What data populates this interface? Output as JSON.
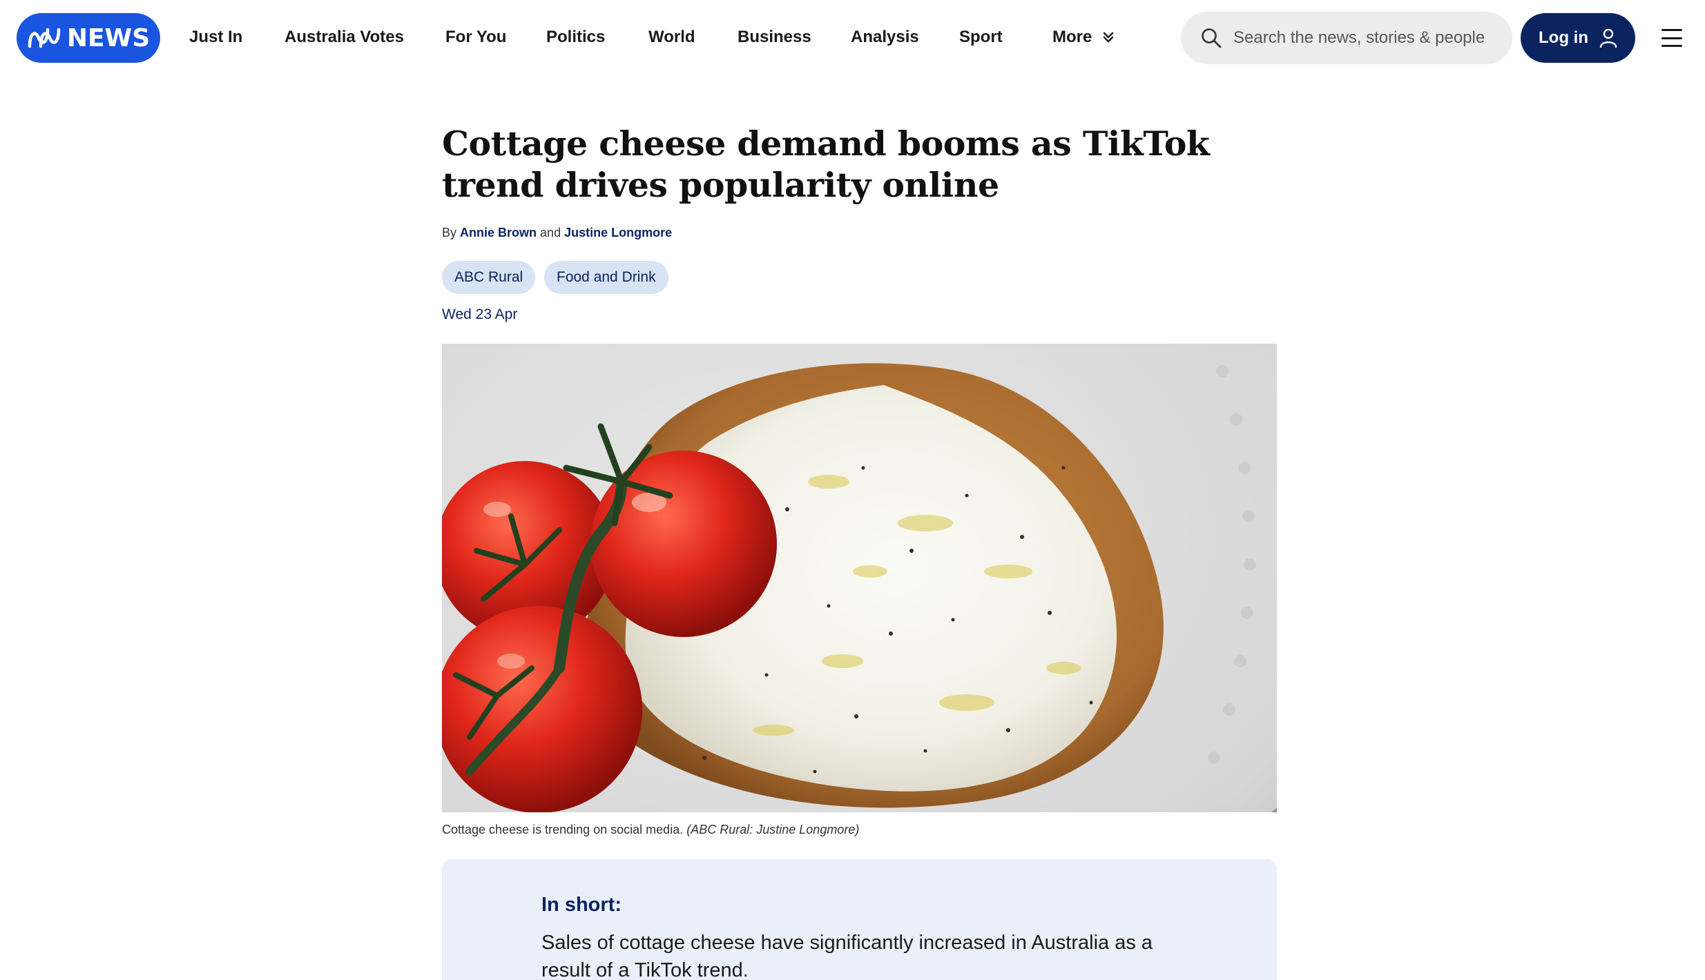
{
  "header": {
    "logo_text": "NEWS",
    "nav": [
      {
        "label": "Just In"
      },
      {
        "label": "Australia Votes"
      },
      {
        "label": "For You"
      },
      {
        "label": "Politics"
      },
      {
        "label": "World"
      },
      {
        "label": "Business"
      },
      {
        "label": "Analysis"
      },
      {
        "label": "Sport"
      },
      {
        "label": "More"
      }
    ],
    "search_placeholder": "Search the news, stories & people",
    "login_label": "Log in"
  },
  "article": {
    "headline": "Cottage cheese demand booms as TikTok trend drives popularity online",
    "byline_prefix": "By",
    "author_1": "Annie Brown",
    "byline_joiner": "and",
    "author_2": "Justine Longmore",
    "tags": [
      "ABC Rural",
      "Food and Drink"
    ],
    "date": "Wed 23 Apr",
    "caption": "Cottage cheese is trending on social media.",
    "caption_credit": "(ABC Rural: Justine Longmore)",
    "in_short_title": "In short:",
    "in_short_text": "Sales of cottage cheese have significantly increased in Australia as a result of a TikTok trend."
  },
  "colors": {
    "brand_blue": "#1a55e0",
    "navy": "#0b2460",
    "tag_bg": "#d8e3f4",
    "summary_bg": "#eaf0f9"
  },
  "icons": [
    "abc-logo-icon",
    "chevron-down-icon",
    "search-icon",
    "user-icon",
    "menu-icon"
  ]
}
